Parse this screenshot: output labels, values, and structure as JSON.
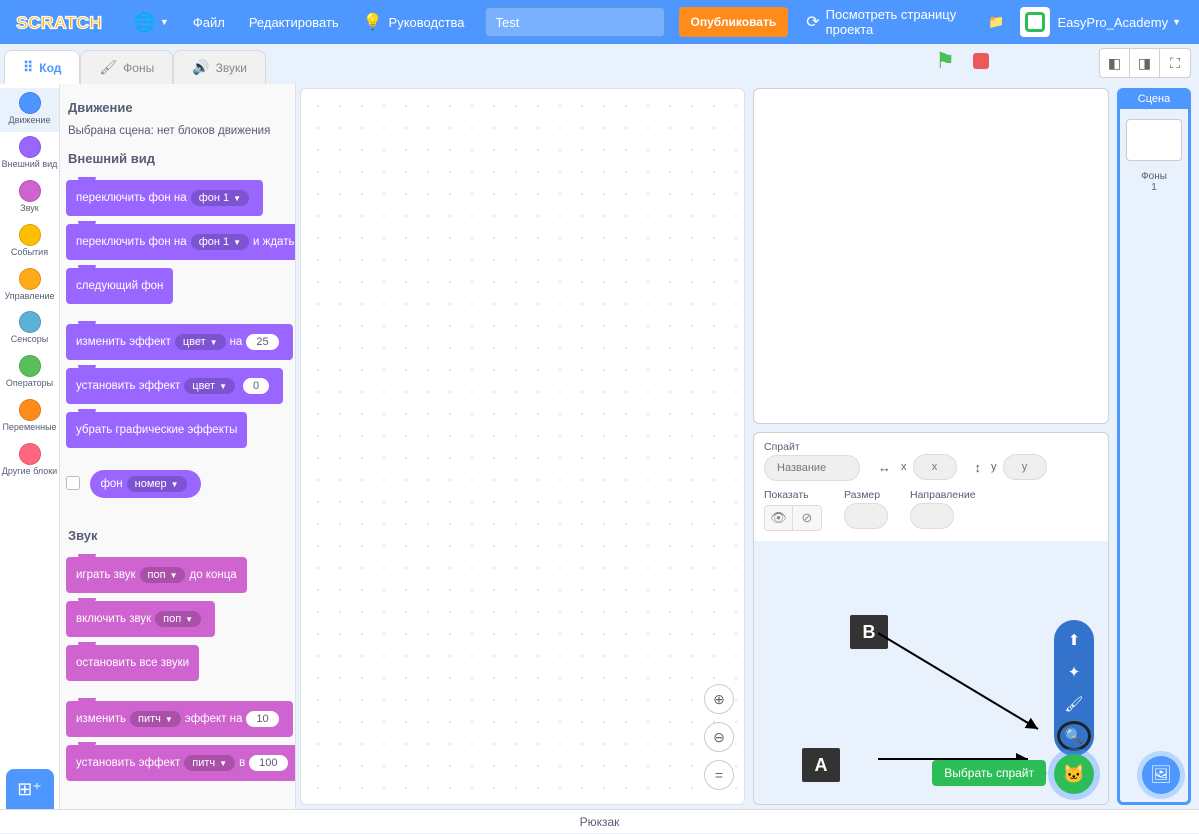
{
  "menubar": {
    "file": "Файл",
    "edit": "Редактировать",
    "tutorials": "Руководства",
    "project_title": "Test",
    "share": "Опубликовать",
    "see_project": "Посмотреть страницу проекта",
    "username": "EasyPro_Academy"
  },
  "tabs": {
    "code": "Код",
    "costumes": "Фоны",
    "sounds": "Звуки"
  },
  "categories": [
    {
      "name": "Движение",
      "color": "#4c97ff"
    },
    {
      "name": "Внешний вид",
      "color": "#9966ff"
    },
    {
      "name": "Звук",
      "color": "#cf63cf"
    },
    {
      "name": "События",
      "color": "#ffbf00"
    },
    {
      "name": "Управление",
      "color": "#ffab19"
    },
    {
      "name": "Сенсоры",
      "color": "#5cb1d6"
    },
    {
      "name": "Операторы",
      "color": "#59c059"
    },
    {
      "name": "Переменные",
      "color": "#ff8c1a"
    },
    {
      "name": "Другие блоки",
      "color": "#ff6680"
    }
  ],
  "palette": {
    "motion_title": "Движение",
    "motion_note": "Выбрана сцена: нет блоков движения",
    "looks_title": "Внешний вид",
    "looks": {
      "switch_backdrop": "переключить фон на",
      "backdrop1": "фон 1",
      "switch_backdrop_wait_a": "переключить фон на",
      "switch_backdrop_wait_b": "и ждать",
      "next_backdrop": "следующий фон",
      "change_effect_a": "изменить эффект",
      "change_effect_b": "на",
      "effect_color": "цвет",
      "change_effect_val": "25",
      "set_effect_a": "установить эффект",
      "set_effect_val": "0",
      "clear_effects": "убрать графические эффекты",
      "reporter_backdrop": "фон",
      "reporter_number": "номер"
    },
    "sound_title": "Звук",
    "sound": {
      "play_until_a": "играть звук",
      "play_until_b": "до конца",
      "pop": "поп",
      "start_sound": "включить звук",
      "stop_all": "остановить все звуки",
      "change_pitch_a": "изменить",
      "change_pitch_b": "эффект на",
      "pitch": "питч",
      "change_pitch_val": "10",
      "set_pitch_a": "установить эффект",
      "set_pitch_b": "в",
      "set_pitch_val": "100"
    }
  },
  "sprite_panel": {
    "sprite_label": "Спрайт",
    "name_placeholder": "Название",
    "x_label": "x",
    "y_label": "y",
    "x_val": "x",
    "y_val": "y",
    "show_label": "Показать",
    "size_label": "Размер",
    "direction_label": "Направление",
    "choose_sprite_tooltip": "Выбрать спрайт"
  },
  "stage_selector": {
    "title": "Сцена",
    "backdrops_label": "Фоны",
    "backdrops_count": "1"
  },
  "backpack": "Рюкзак",
  "annotations": {
    "a": "A",
    "b": "B"
  }
}
